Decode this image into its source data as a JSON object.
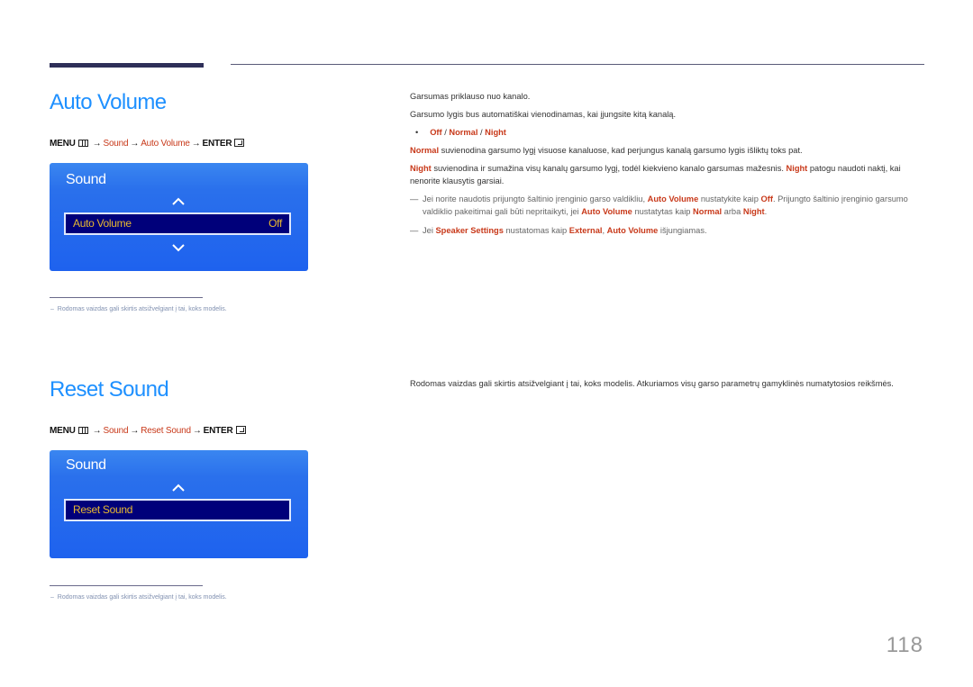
{
  "page_number": "118",
  "sections": [
    {
      "title": "Auto Volume",
      "menu_path": {
        "menu": "MENU",
        "arrow": "→",
        "steps": [
          "Sound",
          "Auto Volume"
        ],
        "enter": "ENTER"
      },
      "osd": {
        "title": "Sound",
        "item_label": "Auto Volume",
        "item_value": "Off"
      },
      "footnote": "Rodomas vaizdas gali skirtis atsižvelgiant į tai, koks modelis.",
      "description": {
        "p1": "Garsumas priklauso nuo kanalo.",
        "p2": "Garsumo lygis bus automatiškai vienodinamas, kai įjungsite kitą kanalą.",
        "options": [
          "Off",
          "Normal",
          "Night"
        ],
        "option_sep": " / ",
        "normal_term": "Normal",
        "normal_text": " suvienodina garsumo lygį visuose kanaluose, kad perjungus kanalą garsumo lygis išliktų toks pat.",
        "night_term": "Night",
        "night_text_a": " suvienodina ir sumažina visų kanalų garsumo lygį, todėl kiekvieno kanalo garsumas mažesnis. ",
        "night_term2": "Night",
        "night_text_b": " patogu naudoti naktį, kai nenorite klausytis garsiai.",
        "note1": {
          "t1": "Jei norite naudotis prijungto šaltinio įrenginio garso valdikliu, ",
          "k1": "Auto Volume",
          "t2": " nustatykite kaip ",
          "k2": "Off",
          "t3": ". Prijungto šaltinio įrenginio garsumo valdiklio pakeitimai gali būti nepritaikyti, jei ",
          "k3": "Auto Volume",
          "t4": " nustatytas kaip ",
          "k4": "Normal",
          "t5": " arba ",
          "k5": "Night",
          "t6": "."
        },
        "note2": {
          "t1": "Jei ",
          "k1": "Speaker Settings",
          "t2": " nustatomas kaip ",
          "k2": "External",
          "t3": ", ",
          "k3": "Auto Volume",
          "t4": " išjungiamas."
        }
      }
    },
    {
      "title": "Reset Sound",
      "menu_path": {
        "menu": "MENU",
        "arrow": "→",
        "steps": [
          "Sound",
          "Reset Sound"
        ],
        "enter": "ENTER"
      },
      "osd": {
        "title": "Sound",
        "item_label": "Reset Sound"
      },
      "footnote": "Rodomas vaizdas gali skirtis atsižvelgiant į tai, koks modelis.",
      "description": {
        "p1": "Rodomas vaizdas gali skirtis atsižvelgiant į tai, koks modelis. Atkuriamos visų garso parametrų gamyklinės numatytosios reikšmės."
      }
    }
  ],
  "note_dash": "—",
  "bullet": "•",
  "footnote_dash": "–"
}
